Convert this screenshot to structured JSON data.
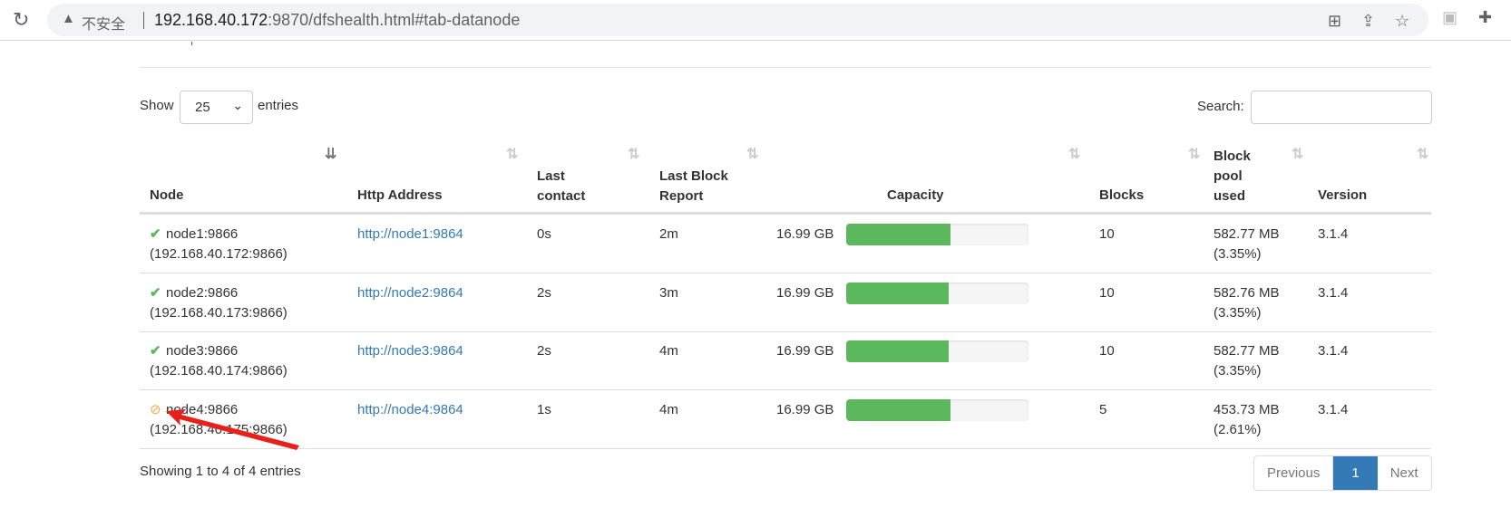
{
  "browser": {
    "insecure_label": "不安全",
    "url_host": "192.168.40.172",
    "url_rest": ":9870/dfshealth.html#tab-datanode"
  },
  "controls": {
    "show_label": "Show",
    "page_size": "25",
    "entries_label": "entries",
    "search_label": "Search:",
    "search_value": ""
  },
  "table": {
    "headers": [
      "Node",
      "Http Address",
      "Last contact",
      "Last Block Report",
      "Capacity",
      "Blocks",
      "Block pool used",
      "Version"
    ],
    "sorted_column": "Node",
    "rows": [
      {
        "status": "in-service",
        "node": "node1:9866",
        "ip": "(192.168.40.172:9866)",
        "http": "http://node1:9864",
        "last_contact": "0s",
        "last_block_report": "2m",
        "capacity": "16.99 GB",
        "usage_percent": 57,
        "blocks": "10",
        "pool_used": "582.77 MB",
        "pool_pct": "(3.35%)",
        "version": "3.1.4"
      },
      {
        "status": "in-service",
        "node": "node2:9866",
        "ip": "(192.168.40.173:9866)",
        "http": "http://node2:9864",
        "last_contact": "2s",
        "last_block_report": "3m",
        "capacity": "16.99 GB",
        "usage_percent": 56,
        "blocks": "10",
        "pool_used": "582.76 MB",
        "pool_pct": "(3.35%)",
        "version": "3.1.4"
      },
      {
        "status": "in-service",
        "node": "node3:9866",
        "ip": "(192.168.40.174:9866)",
        "http": "http://node3:9864",
        "last_contact": "2s",
        "last_block_report": "4m",
        "capacity": "16.99 GB",
        "usage_percent": 56,
        "blocks": "10",
        "pool_used": "582.77 MB",
        "pool_pct": "(3.35%)",
        "version": "3.1.4"
      },
      {
        "status": "decommissioned",
        "node": "node4:9866",
        "ip": "(192.168.40.175:9866)",
        "http": "http://node4:9864",
        "last_contact": "1s",
        "last_block_report": "4m",
        "capacity": "16.99 GB",
        "usage_percent": 57,
        "blocks": "5",
        "pool_used": "453.73 MB",
        "pool_pct": "(2.61%)",
        "version": "3.1.4"
      }
    ]
  },
  "footer": {
    "info": "Showing 1 to 4 of 4 entries",
    "previous": "Previous",
    "current_page": "1",
    "next": "Next"
  },
  "colors": {
    "ok": "#5cb85c",
    "warning": "#f0ad4e",
    "link": "#337ab7",
    "annotation_arrow": "#e8201a"
  }
}
